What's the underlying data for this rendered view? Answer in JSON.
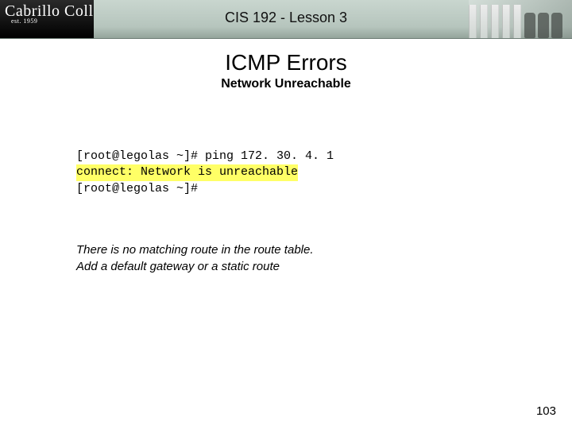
{
  "header": {
    "logo_script": "Cabrillo College",
    "logo_sub": "est. 1959",
    "course_title": "CIS 192 - Lesson 3"
  },
  "slide": {
    "title": "ICMP Errors",
    "subtitle": "Network Unreachable"
  },
  "terminal": {
    "line1": "[root@legolas ~]# ping 172. 30. 4. 1",
    "line2_highlight": "connect: Network is unreachable",
    "line3": "[root@legolas ~]#"
  },
  "explain": {
    "line1": "There is no matching route in the route table.",
    "line2": "Add a default gateway or a static route"
  },
  "page_number": "103"
}
